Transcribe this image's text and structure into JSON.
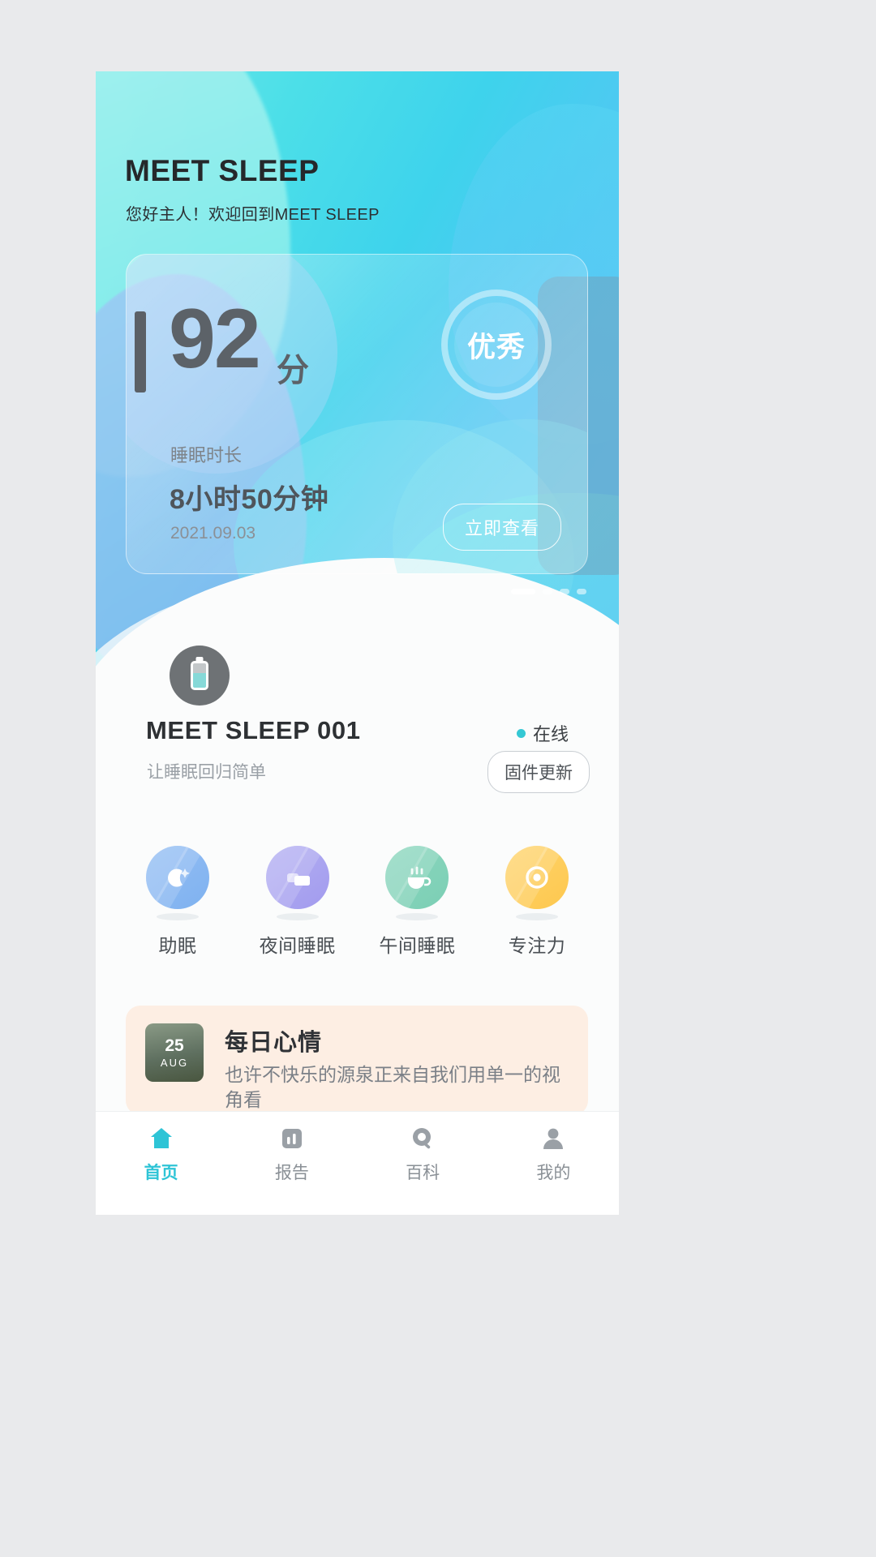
{
  "header": {
    "title": "MEET SLEEP",
    "subtitle": "您好主人！欢迎回到MEET SLEEP"
  },
  "score_card": {
    "score": "92",
    "score_unit": "分",
    "rank_badge": "优秀",
    "duration_label": "睡眠时长",
    "duration_value": "8小时50分钟",
    "date": "2021.09.03",
    "view_button": "立即查看",
    "pagination": {
      "total": 4,
      "active_index": 0
    }
  },
  "device": {
    "name": "MEET SLEEP 001",
    "slogan": "让睡眠回归简单",
    "status_label": "在线",
    "status_color": "#35c8d4",
    "firmware_button": "固件更新",
    "battery_icon": "battery-icon"
  },
  "features": [
    {
      "label": "助眠",
      "icon": "moon-star-icon",
      "color": "#7fb2f0"
    },
    {
      "label": "夜间睡眠",
      "icon": "bed-icon",
      "color": "#a29bee"
    },
    {
      "label": "午间睡眠",
      "icon": "coffee-cup-icon",
      "color": "#7ccfb5"
    },
    {
      "label": "专注力",
      "icon": "target-icon",
      "color": "#fdc84f"
    }
  ],
  "mood_card": {
    "day": "25",
    "month": "AUG",
    "title": "每日心情",
    "body": "也许不快乐的源泉正来自我们用单一的视角看"
  },
  "bottom_nav": [
    {
      "label": "首页",
      "icon": "home-icon",
      "active": true
    },
    {
      "label": "报告",
      "icon": "chart-icon",
      "active": false
    },
    {
      "label": "百科",
      "icon": "search-icon",
      "active": false
    },
    {
      "label": "我的",
      "icon": "user-icon",
      "active": false
    }
  ],
  "theme": {
    "accent": "#2ec4d6",
    "hero_start": "#6ee6ea",
    "hero_end": "#63c2f5"
  }
}
